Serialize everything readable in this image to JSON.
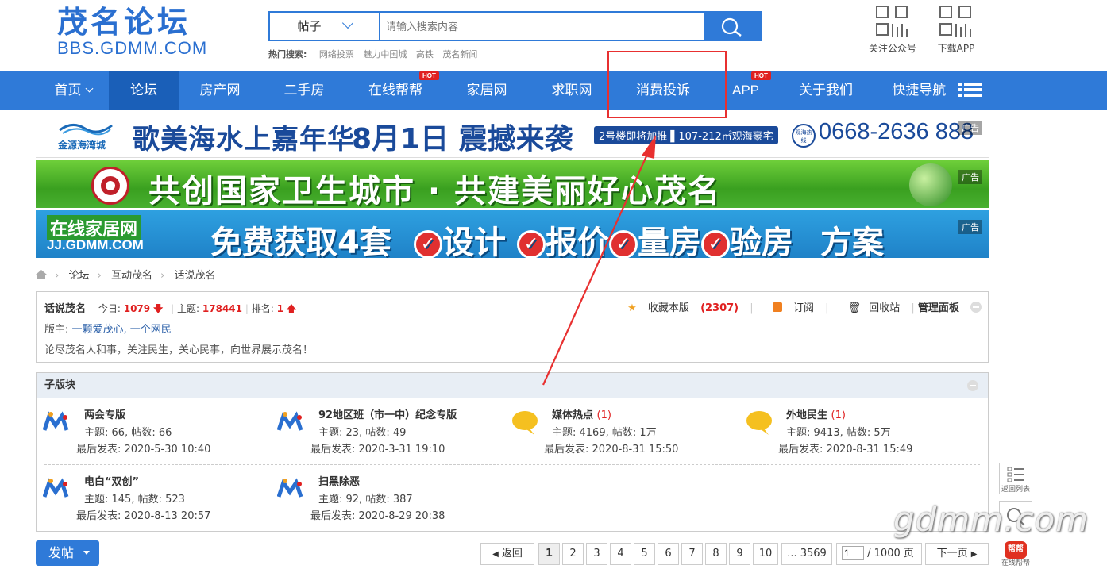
{
  "header": {
    "logo_cn": "茂名论坛",
    "logo_url": "BBS.GDMM.COM",
    "search": {
      "type_label": "帖子",
      "placeholder": "请输入搜索内容"
    },
    "hot_label": "热门搜索:",
    "hot_items": [
      "网络投票",
      "魅力中国城",
      "高铁",
      "茂名新闻"
    ],
    "qr_follow": "关注公众号",
    "qr_app": "下载APP"
  },
  "nav": {
    "items": [
      {
        "label": "首页"
      },
      {
        "label": "论坛"
      },
      {
        "label": "房产网"
      },
      {
        "label": "二手房"
      },
      {
        "label": "在线帮帮"
      },
      {
        "label": "家居网"
      },
      {
        "label": "求职网"
      },
      {
        "label": "消费投诉"
      },
      {
        "label": "APP"
      },
      {
        "label": "关于我们"
      },
      {
        "label": "快捷导航"
      }
    ],
    "hot_badge": "HOT"
  },
  "banners": {
    "b1": {
      "brand": "金源海湾城",
      "headline": "歌美海水上嘉年华",
      "date": "8月1日 震撼来袭",
      "tag": "2号楼即将加推 ▌107-212㎡观海豪宅",
      "hotline_label": "观海热线",
      "phone": "0668-2636 888"
    },
    "b2": {
      "text": "共创国家卫生城市 · 共建美丽好心茂名"
    },
    "b3": {
      "brand": "在线家居网",
      "brand_url": "JJ.GDMM.COM",
      "text": "免费获取4套",
      "items": [
        "设计",
        "报价",
        "量房",
        "验房"
      ],
      "tail": "方案"
    },
    "ad_label": "广告"
  },
  "breadcrumb": [
    "论坛",
    "互动茂名",
    "话说茂名"
  ],
  "forum_info": {
    "title": "话说茂名",
    "today_label": "今日:",
    "today": "1079",
    "topics_label": "主题:",
    "topics": "178441",
    "rank_label": "排名:",
    "rank": "1",
    "moderator_label": "版主:",
    "moderators": "一颗爱茂心, 一个网民",
    "desc": "论尽茂名人和事，关注民生，关心民事，向世界展示茂名！",
    "fav_label": "收藏本版",
    "fav_count": "(2307)",
    "subscribe": "订阅",
    "recycle": "回收站",
    "manage": "管理面板"
  },
  "subforums": {
    "title": "子版块",
    "items": [
      {
        "name": "两会专版",
        "count": "",
        "stat": "主题: 66, 帖数: 66",
        "last": "最后发表: 2020-5-30 10:40",
        "icon": "mm-logo-icon"
      },
      {
        "name": "92地区班（市一中）纪念专版",
        "count": "",
        "stat": "主题: 23, 帖数: 49",
        "last": "最后发表: 2020-3-31 19:10",
        "icon": "mm-logo-icon"
      },
      {
        "name": "媒体热点",
        "count": "(1)",
        "stat": "主题: 4169, 帖数: 1万",
        "last": "最后发表: 2020-8-31 15:50",
        "icon": "speech-bubble-icon"
      },
      {
        "name": "外地民生",
        "count": "(1)",
        "stat": "主题: 9413, 帖数: 5万",
        "last": "最后发表: 2020-8-31 15:49",
        "icon": "speech-bubble-icon"
      },
      {
        "name": "电白“双创”",
        "count": "",
        "stat": "主题: 145, 帖数: 523",
        "last": "最后发表: 2020-8-13 20:57",
        "icon": "mm-logo-icon"
      },
      {
        "name": "扫黑除恶",
        "count": "",
        "stat": "主题: 92, 帖数: 387",
        "last": "最后发表: 2020-8-29 20:38",
        "icon": "mm-logo-icon"
      }
    ]
  },
  "post_button": "发帖",
  "pagination": {
    "prev": "返回",
    "pages": [
      "1",
      "2",
      "3",
      "4",
      "5",
      "6",
      "7",
      "8",
      "9",
      "10"
    ],
    "last": "... 3569",
    "jump_value": "1",
    "total": "/ 1000 页",
    "next": "下一页"
  },
  "side_tools": {
    "back_to_list": "返回列表",
    "help": "在线帮帮",
    "help_badge": "帮帮"
  },
  "watermark": "gdmm.com",
  "colors": {
    "brand_blue": "#2f7ad8",
    "active_nav": "#1a5fb8",
    "highlight_red": "#e02020",
    "annotation_red": "#e83030"
  }
}
